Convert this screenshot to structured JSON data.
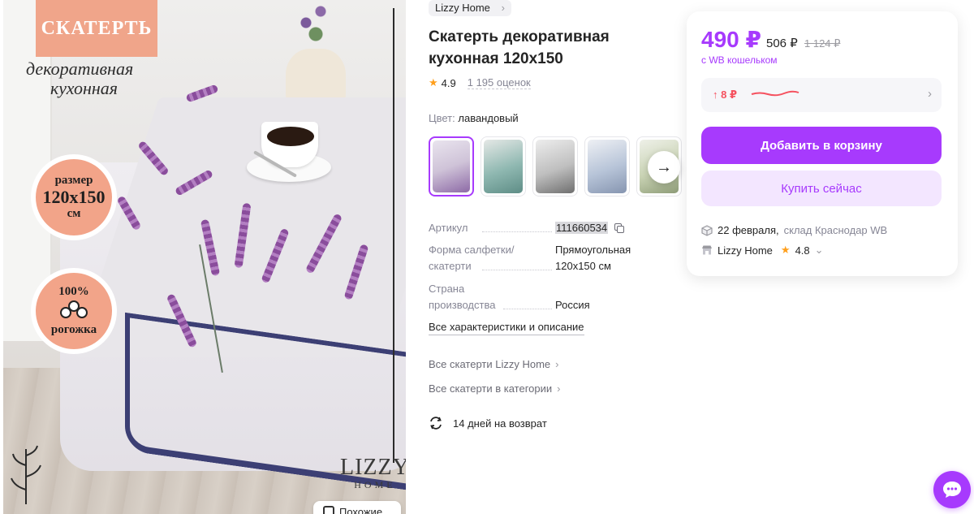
{
  "image": {
    "title": "СКАТЕРТЬ",
    "subtitle_1": "декоративная",
    "subtitle_2": "кухонная",
    "badge_size_top": "размер",
    "badge_size_value": "120х150",
    "badge_size_unit": "см",
    "badge_material_top": "100%",
    "badge_material_bottom": "рогожка",
    "logo_main": "LIZZY",
    "logo_sub": "HOME",
    "similar_label": "Похожие"
  },
  "product": {
    "brand": "Lizzy Home",
    "title": "Скатерть декоративная кухонная 120х150",
    "rating": "4.9",
    "reviews": "1 195 оценок",
    "color_label": "Цвет:",
    "color_value": "лавандовый",
    "thumbnails": [
      {
        "tone": "#cfc3d8"
      },
      {
        "tone": "#8fb8b1"
      },
      {
        "tone": "#bfbfbf"
      },
      {
        "tone": "#b7c4d8"
      },
      {
        "tone": "#c9d3b4"
      }
    ],
    "specs": {
      "article_label": "Артикул",
      "article_value": "111660534",
      "shape_label_1": "Форма салфетки/",
      "shape_label_2": "скатерти",
      "shape_value_1": "Прямоугольная",
      "shape_value_2": "120х150 см",
      "country_label_1": "Страна",
      "country_label_2": "производства",
      "country_value": "Россия"
    },
    "all_specs_link": "Все характеристики и описание",
    "link_brand": "Все скатерти Lizzy Home",
    "link_category": "Все скатерти в категории",
    "return_text": "14 дней на возврат"
  },
  "buy": {
    "price": "490 ₽",
    "price_old": "506 ₽",
    "price_strike": "1 124 ₽",
    "wallet_note": "с WB кошельком",
    "price_delta": "↑ 8 ₽",
    "add_to_cart": "Добавить в корзину",
    "buy_now": "Купить сейчас",
    "delivery_date": "22 февраля,",
    "delivery_warehouse": "склад Краснодар WB",
    "seller": "Lizzy Home",
    "seller_rating": "4.8"
  },
  "colors": {
    "accent": "#a73afd",
    "accent_light": "#f3e6ff",
    "price_up": "#f5515f",
    "star": "#ff9f1c"
  }
}
